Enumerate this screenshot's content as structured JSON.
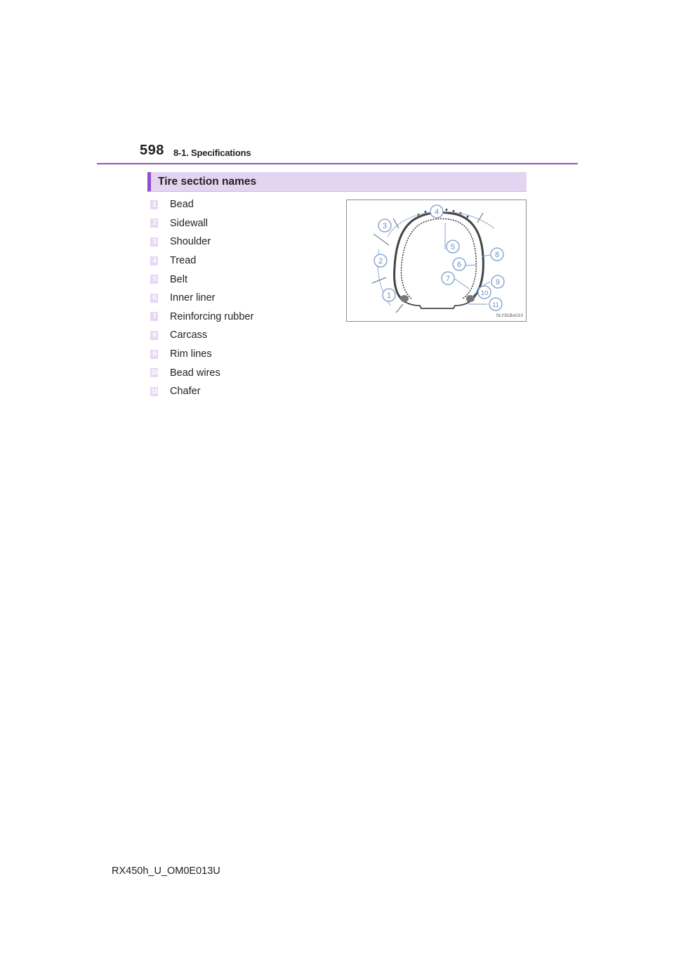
{
  "header": {
    "page_number": "598",
    "section_ref": "8-1. Specifications"
  },
  "section": {
    "title": "Tire section names"
  },
  "parts": [
    {
      "number": "1",
      "label": "Bead"
    },
    {
      "number": "2",
      "label": "Sidewall"
    },
    {
      "number": "3",
      "label": "Shoulder"
    },
    {
      "number": "4",
      "label": "Tread"
    },
    {
      "number": "5",
      "label": "Belt"
    },
    {
      "number": "6",
      "label": "Inner liner"
    },
    {
      "number": "7",
      "label": "Reinforcing rubber"
    },
    {
      "number": "8",
      "label": "Carcass"
    },
    {
      "number": "9",
      "label": "Rim lines"
    },
    {
      "number": "10",
      "label": "Bead wires"
    },
    {
      "number": "11",
      "label": "Chafer"
    }
  ],
  "figure": {
    "code": "SLY91BA010",
    "callouts": [
      "1",
      "2",
      "3",
      "4",
      "5",
      "6",
      "7",
      "8",
      "9",
      "10",
      "11"
    ]
  },
  "footer": {
    "doc_id": "RX450h_U_OM0E013U"
  },
  "colors": {
    "accent": "#8c52c6",
    "heading_bg": "#e3d4f2",
    "badge_bg": "#e6d7f3"
  }
}
